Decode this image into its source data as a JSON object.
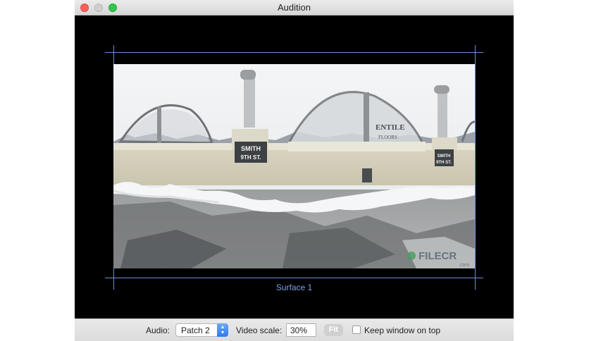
{
  "window": {
    "title": "Audition"
  },
  "canvas": {
    "surface_label": "Surface 1",
    "video": {
      "sign_left": [
        "SMITH",
        "9TH ST."
      ],
      "sign_right": [
        "SMITH",
        "9TH ST."
      ],
      "wall_text": [
        "ENTILE",
        "FLOORS"
      ],
      "watermark": "FILECR",
      "watermark_sub": ".com"
    }
  },
  "controls": {
    "audio_label": "Audio:",
    "audio_value": "Patch 2",
    "video_scale_label": "Video scale:",
    "video_scale_value": "30%",
    "fit_label": "Fit",
    "keep_on_top_label": "Keep window on top",
    "keep_on_top_checked": false
  },
  "colors": {
    "guide": "#6a8fd6",
    "surface_label": "#7ea3e6",
    "close": "#fc605c",
    "maximize": "#34c84a",
    "popup_accent": "#2f79ea"
  }
}
